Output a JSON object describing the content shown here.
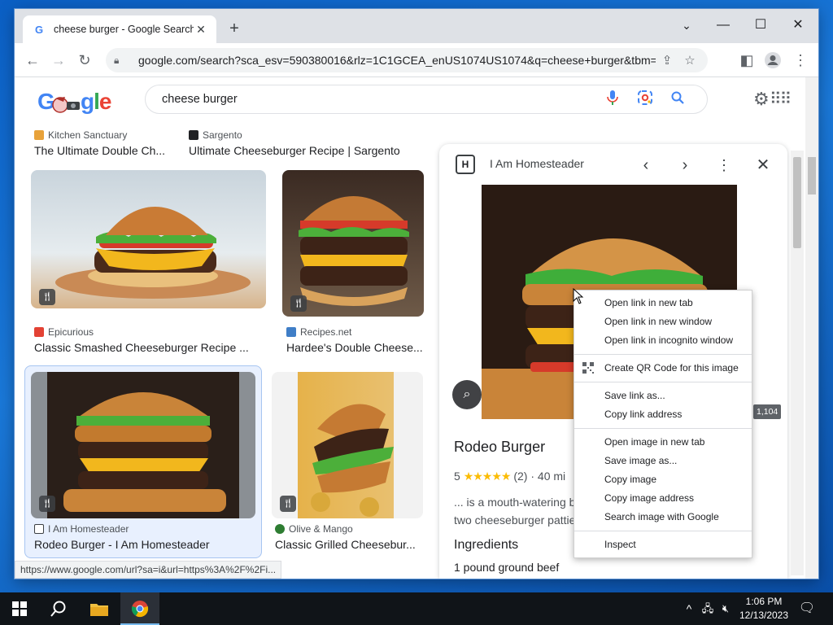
{
  "browser": {
    "tab_title": "cheese burger - Google Search",
    "tab_favicon": "G",
    "url": "google.com/search?sca_esv=590380016&rlz=1C1GCEA_enUS1074US1074&q=cheese+burger&tbm=isch...",
    "status_url": "https://www.google.com/url?sa=i&url=https%3A%2F%2Fi..."
  },
  "search": {
    "logo": "Google",
    "query": "cheese burger"
  },
  "results": [
    {
      "source": "Kitchen Sanctuary",
      "title": "The Ultimate Double Ch..."
    },
    {
      "source": "Sargento",
      "title": "Ultimate Cheeseburger Recipe | Sargento"
    },
    {
      "source": "Epicurious",
      "title": "Classic Smashed Cheeseburger Recipe ..."
    },
    {
      "source": "Recipes.net",
      "title": "Hardee's Double Cheese..."
    },
    {
      "source": "I Am Homesteader",
      "title": "Rodeo Burger - I Am Homesteader"
    },
    {
      "source": "Olive & Mango",
      "title": "Classic Grilled Cheesebur..."
    }
  ],
  "panel": {
    "site": "I Am Homesteader",
    "logo_letter": "H",
    "dimensions": "1,104",
    "title": "Rodeo Burger",
    "rating_value": "5",
    "stars": "★★★★★",
    "rating_count": "(2)",
    "time": "40 mi",
    "snippet_1": "... is a mouth-watering b",
    "snippet_2": "two cheeseburger pattie",
    "ingredients_heading": "Ingredients",
    "ingredient_1": "1 pound ground beef"
  },
  "context_menu": {
    "group1": [
      "Open link in new tab",
      "Open link in new window",
      "Open link in incognito window"
    ],
    "group2": [
      "Create QR Code for this image"
    ],
    "group3": [
      "Save link as...",
      "Copy link address"
    ],
    "group4": [
      "Open image in new tab",
      "Save image as...",
      "Copy image",
      "Copy image address",
      "Search image with Google"
    ],
    "group5": [
      "Inspect"
    ]
  },
  "taskbar": {
    "time": "1:06 PM",
    "date": "12/13/2023"
  },
  "colors": {
    "accent": "#1a73e8",
    "selected_card": "#e8f0fe",
    "stars": "#fbbc04"
  }
}
